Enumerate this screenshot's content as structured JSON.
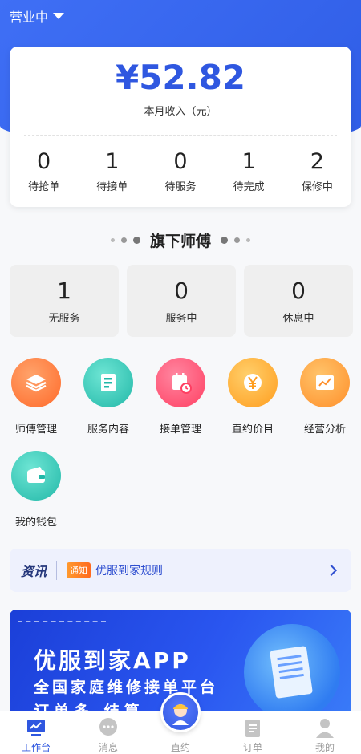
{
  "header": {
    "status_label": "营业中",
    "icons": [
      "chevron-down-icon"
    ]
  },
  "income": {
    "amount": "¥52.82",
    "label": "本月收入（元）"
  },
  "order_stats": [
    {
      "value": "0",
      "label": "待抢单"
    },
    {
      "value": "1",
      "label": "待接单"
    },
    {
      "value": "0",
      "label": "待服务"
    },
    {
      "value": "1",
      "label": "待完成"
    },
    {
      "value": "2",
      "label": "保修中"
    }
  ],
  "masters": {
    "title": "旗下师傅",
    "stats": [
      {
        "value": "1",
        "label": "无服务"
      },
      {
        "value": "0",
        "label": "服务中"
      },
      {
        "value": "0",
        "label": "休息中"
      }
    ]
  },
  "menu": [
    {
      "label": "师傅管理",
      "icon": "layers-icon",
      "color": "#ff7b3a"
    },
    {
      "label": "服务内容",
      "icon": "document-icon",
      "color": "#31c9b8"
    },
    {
      "label": "接单管理",
      "icon": "calendar-clock-icon",
      "color": "#ff4d6d"
    },
    {
      "label": "直约价目",
      "icon": "yen-icon",
      "color": "#ffa928"
    },
    {
      "label": "经营分析",
      "icon": "chart-icon",
      "color": "#ff9a2e"
    },
    {
      "label": "我的钱包",
      "icon": "wallet-icon",
      "color": "#31c9b8"
    }
  ],
  "news": {
    "tag": "资讯",
    "badge": "通知",
    "text": "优服到家规则"
  },
  "banner": {
    "title": "优服到家APP",
    "subtitle": "全国家庭维修接单平台",
    "subtitle2": "订单多 结算"
  },
  "tabbar": [
    {
      "label": "工作台",
      "icon": "dashboard-icon"
    },
    {
      "label": "消息",
      "icon": "chat-icon"
    },
    {
      "label": "直约",
      "icon": "worker-icon"
    },
    {
      "label": "订单",
      "icon": "clipboard-icon"
    },
    {
      "label": "我的",
      "icon": "user-icon"
    }
  ],
  "colors": {
    "primary": "#2f57e0",
    "header_bg": "#3f6ff5"
  }
}
